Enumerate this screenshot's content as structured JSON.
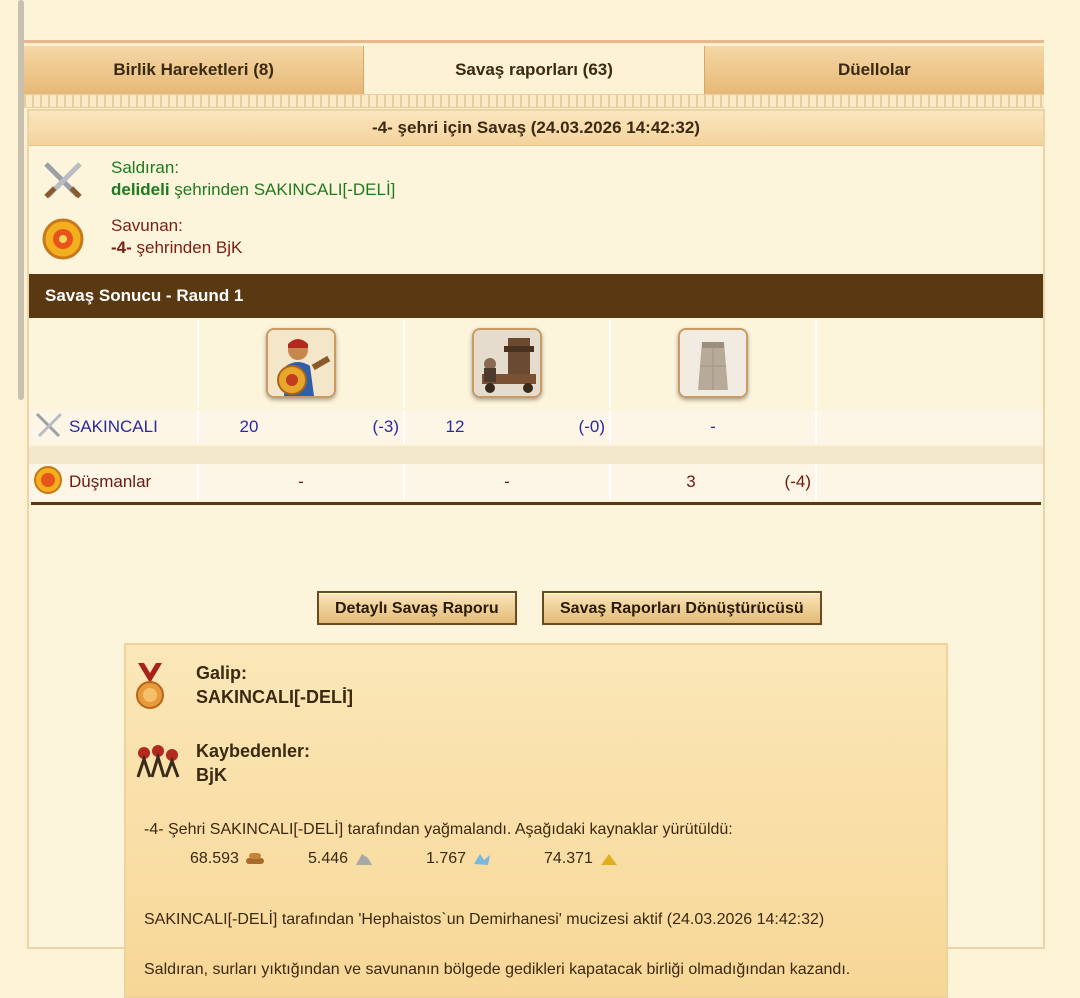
{
  "tabs": [
    {
      "label": "Birlik Hareketleri (8)"
    },
    {
      "label": "Savaş raporları (63)"
    },
    {
      "label": "Düellolar"
    }
  ],
  "report": {
    "title": "-4- şehri için Savaş (24.03.2026 14:42:32)",
    "attacker": {
      "label": "Saldıran:",
      "city": "delideli",
      "rest": " şehrinden SAKINCALI[-DELİ]"
    },
    "defender": {
      "label": "Savunan:",
      "city": "-4-",
      "rest": " şehrinden BjK"
    }
  },
  "battle": {
    "header": "Savaş Sonucu - Raund 1",
    "units": [
      "hoplite-unit",
      "catapult-unit",
      "wall-unit"
    ],
    "attacker_row": {
      "name": "SAKINCALI",
      "c1": "20",
      "l1": "(-3)",
      "c2": "12",
      "l2": "(-0)",
      "c3": "-"
    },
    "defender_row": {
      "name": "Düşmanlar",
      "c1": "-",
      "c2": "-",
      "c3": "3",
      "l3": "(-4)"
    }
  },
  "buttons": {
    "detailed": "Detaylı Savaş Raporu",
    "converter": "Savaş Raporları Dönüştürücüsü"
  },
  "result": {
    "winner_label": "Galip:",
    "winner": "SAKINCALI[-DELİ]",
    "losers_label": "Kaybedenler:",
    "losers": "BjK",
    "loot_text": "-4- Şehri SAKINCALI[-DELİ] tarafından yağmalandı. Aşağıdaki kaynaklar yürütüldü:",
    "resources": [
      {
        "value": "68.593",
        "icon": "wood-icon"
      },
      {
        "value": "5.446",
        "icon": "marble-icon"
      },
      {
        "value": "1.767",
        "icon": "crystal-icon"
      },
      {
        "value": "74.371",
        "icon": "sulfur-icon"
      }
    ],
    "wonder_text": "SAKINCALI[-DELİ] tarafından 'Hephaistos`un Demirhanesi' mucizesi aktif (24.03.2026 14:42:32)",
    "final_text": "Saldıran, surları yıktığından ve savunanın bölgede gedikleri kapatacak birliği olmadığından kazandı."
  }
}
